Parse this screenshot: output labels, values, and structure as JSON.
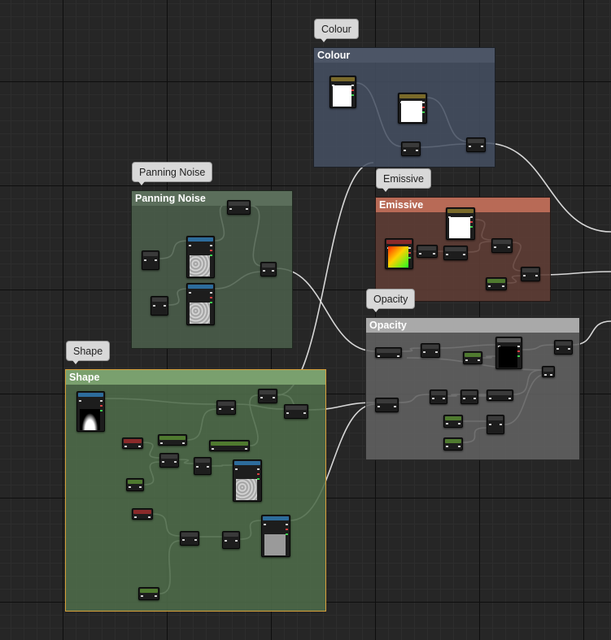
{
  "comments": {
    "colour": {
      "bubble": "Colour",
      "title": "Colour"
    },
    "panning_noise": {
      "bubble": "Panning Noise",
      "title": "Panning Noise"
    },
    "emissive": {
      "bubble": "Emissive",
      "title": "Emissive"
    },
    "opacity": {
      "bubble": "Opacity",
      "title": "Opacity"
    },
    "shape": {
      "bubble": "Shape",
      "title": "Shape"
    }
  },
  "colors": {
    "colour_group": "#3f4756",
    "panning_group": "#4f5f4f",
    "emissive_group": "#5c3f38",
    "opacity_group": "#5c5c5c",
    "shape_group": "#4d6b4a",
    "shape_border": "#d9a23a",
    "wire": "#e6e6e6"
  }
}
